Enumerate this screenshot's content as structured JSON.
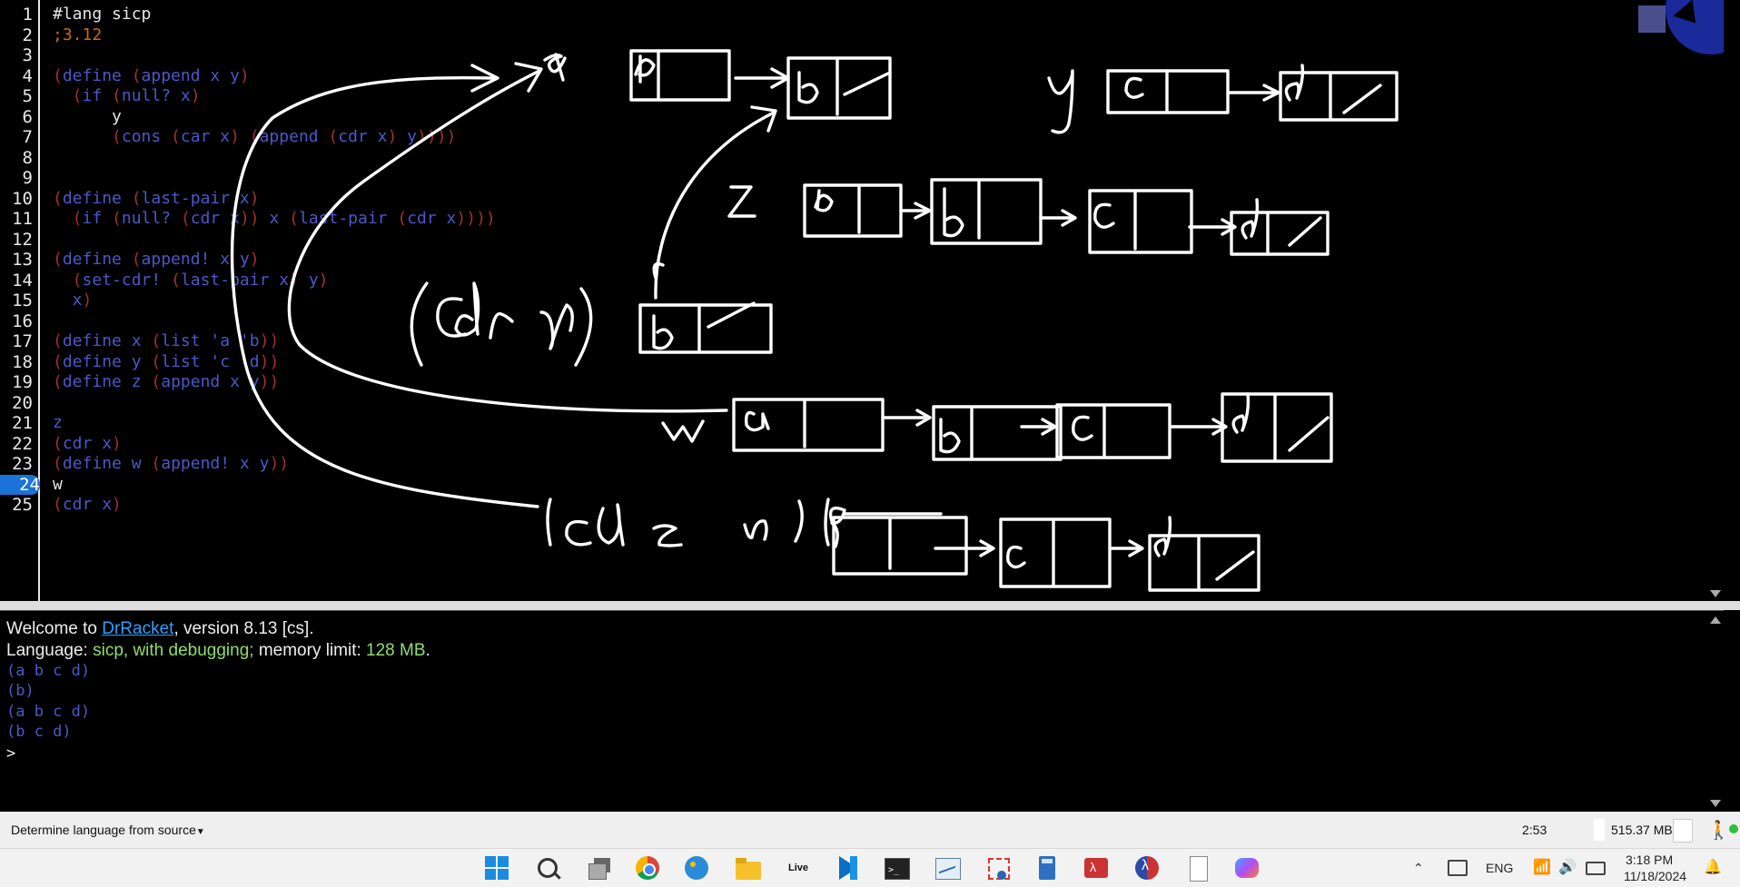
{
  "editor": {
    "active_line": 24,
    "lines": [
      {
        "n": "1",
        "tokens": [
          {
            "t": "#lang sicp",
            "c": "text"
          }
        ]
      },
      {
        "n": "2",
        "tokens": [
          {
            "t": ";3.12",
            "c": "comment"
          }
        ]
      },
      {
        "n": "3",
        "tokens": []
      },
      {
        "n": "4",
        "tokens": [
          {
            "t": "(",
            "c": "paren"
          },
          {
            "t": "define ",
            "c": "kw"
          },
          {
            "t": "(",
            "c": "paren"
          },
          {
            "t": "append x y",
            "c": "kw"
          },
          {
            "t": ")",
            "c": "paren"
          }
        ]
      },
      {
        "n": "5",
        "tokens": [
          {
            "t": "  (",
            "c": "paren"
          },
          {
            "t": "if ",
            "c": "kw"
          },
          {
            "t": "(",
            "c": "paren"
          },
          {
            "t": "null? x",
            "c": "kw"
          },
          {
            "t": ")",
            "c": "paren"
          }
        ]
      },
      {
        "n": "6",
        "tokens": [
          {
            "t": "      y",
            "c": "text"
          }
        ]
      },
      {
        "n": "7",
        "tokens": [
          {
            "t": "      (",
            "c": "paren"
          },
          {
            "t": "cons ",
            "c": "kw"
          },
          {
            "t": "(",
            "c": "paren"
          },
          {
            "t": "car x",
            "c": "kw"
          },
          {
            "t": ") (",
            "c": "paren"
          },
          {
            "t": "append ",
            "c": "kw"
          },
          {
            "t": "(",
            "c": "paren"
          },
          {
            "t": "cdr x",
            "c": "kw"
          },
          {
            "t": ") ",
            "c": "paren"
          },
          {
            "t": "y",
            "c": "kw"
          },
          {
            "t": "))))",
            "c": "paren"
          }
        ]
      },
      {
        "n": "8",
        "tokens": []
      },
      {
        "n": "9",
        "tokens": []
      },
      {
        "n": "10",
        "tokens": [
          {
            "t": "(",
            "c": "paren"
          },
          {
            "t": "define ",
            "c": "kw"
          },
          {
            "t": "(",
            "c": "paren"
          },
          {
            "t": "last-pair x",
            "c": "kw"
          },
          {
            "t": ")",
            "c": "paren"
          }
        ]
      },
      {
        "n": "11",
        "tokens": [
          {
            "t": "  (",
            "c": "paren"
          },
          {
            "t": "if ",
            "c": "kw"
          },
          {
            "t": "(",
            "c": "paren"
          },
          {
            "t": "null? ",
            "c": "kw"
          },
          {
            "t": "(",
            "c": "paren"
          },
          {
            "t": "cdr x",
            "c": "kw"
          },
          {
            "t": ")) ",
            "c": "paren"
          },
          {
            "t": "x ",
            "c": "kw"
          },
          {
            "t": "(",
            "c": "paren"
          },
          {
            "t": "last-pair ",
            "c": "kw"
          },
          {
            "t": "(",
            "c": "paren"
          },
          {
            "t": "cdr x",
            "c": "kw"
          },
          {
            "t": "))))",
            "c": "paren"
          }
        ]
      },
      {
        "n": "12",
        "tokens": []
      },
      {
        "n": "13",
        "tokens": [
          {
            "t": "(",
            "c": "paren"
          },
          {
            "t": "define ",
            "c": "kw"
          },
          {
            "t": "(",
            "c": "paren"
          },
          {
            "t": "append! x y",
            "c": "kw"
          },
          {
            "t": ")",
            "c": "paren"
          }
        ]
      },
      {
        "n": "14",
        "tokens": [
          {
            "t": "  (",
            "c": "paren"
          },
          {
            "t": "set-cdr! ",
            "c": "kw"
          },
          {
            "t": "(",
            "c": "paren"
          },
          {
            "t": "last-pair x",
            "c": "kw"
          },
          {
            "t": ") ",
            "c": "paren"
          },
          {
            "t": "y",
            "c": "kw"
          },
          {
            "t": ")",
            "c": "paren"
          }
        ]
      },
      {
        "n": "15",
        "tokens": [
          {
            "t": "  x",
            "c": "kw"
          },
          {
            "t": ")",
            "c": "paren"
          }
        ]
      },
      {
        "n": "16",
        "tokens": []
      },
      {
        "n": "17",
        "tokens": [
          {
            "t": "(",
            "c": "paren"
          },
          {
            "t": "define x ",
            "c": "kw"
          },
          {
            "t": "(",
            "c": "paren"
          },
          {
            "t": "list 'a 'b",
            "c": "kw"
          },
          {
            "t": "))",
            "c": "paren"
          }
        ]
      },
      {
        "n": "18",
        "tokens": [
          {
            "t": "(",
            "c": "paren"
          },
          {
            "t": "define y ",
            "c": "kw"
          },
          {
            "t": "(",
            "c": "paren"
          },
          {
            "t": "list 'c 'd",
            "c": "kw"
          },
          {
            "t": "))",
            "c": "paren"
          }
        ]
      },
      {
        "n": "19",
        "tokens": [
          {
            "t": "(",
            "c": "paren"
          },
          {
            "t": "define z ",
            "c": "kw"
          },
          {
            "t": "(",
            "c": "paren"
          },
          {
            "t": "append x y",
            "c": "kw"
          },
          {
            "t": "))",
            "c": "paren"
          }
        ]
      },
      {
        "n": "20",
        "tokens": []
      },
      {
        "n": "21",
        "tokens": [
          {
            "t": "z",
            "c": "kw"
          }
        ]
      },
      {
        "n": "22",
        "tokens": [
          {
            "t": "(",
            "c": "paren"
          },
          {
            "t": "cdr x",
            "c": "kw"
          },
          {
            "t": ")",
            "c": "paren"
          }
        ]
      },
      {
        "n": "23",
        "tokens": [
          {
            "t": "(",
            "c": "paren"
          },
          {
            "t": "define w ",
            "c": "kw"
          },
          {
            "t": "(",
            "c": "paren"
          },
          {
            "t": "append! x y",
            "c": "kw"
          },
          {
            "t": "))",
            "c": "paren"
          }
        ]
      },
      {
        "n": "24",
        "tokens": [
          {
            "t": "w",
            "c": "text"
          }
        ]
      },
      {
        "n": "25",
        "tokens": [
          {
            "t": "(",
            "c": "paren"
          },
          {
            "t": "cdr x",
            "c": "kw"
          },
          {
            "t": ")",
            "c": "paren"
          }
        ]
      }
    ]
  },
  "repl": {
    "welcome_prefix": "Welcome to ",
    "app_name": "DrRacket",
    "welcome_suffix": ", version 8.13 [cs].",
    "lang_prefix": "Language: ",
    "lang_name": "sicp, with debugging;",
    "mem_prefix": " memory limit: ",
    "mem_value": "128 MB",
    "mem_suffix": ".",
    "outputs": [
      "(a b c d)",
      "(b)",
      "(a b c d)",
      "(b c d)"
    ],
    "prompt": ">"
  },
  "status": {
    "language_menu": "Determine language from source",
    "position": "2:53",
    "memory": "515.37 MB"
  },
  "taskbar": {
    "apps": [
      "windows-start",
      "search",
      "task-view",
      "chrome",
      "paint",
      "file-explorer",
      "live",
      "vscode",
      "terminal",
      "resource-monitor",
      "snipping-tool",
      "calculator",
      "racket-red",
      "racket",
      "notepad",
      "copilot"
    ],
    "live_label": "Live",
    "lang": "ENG",
    "time": "3:18 PM",
    "date": "11/18/2024"
  },
  "colors": {
    "paren": "#a3302a",
    "keyword": "#4b58c8",
    "comment": "#c66a18",
    "active_line": "#1b73d6",
    "ink": "#ffffff"
  }
}
